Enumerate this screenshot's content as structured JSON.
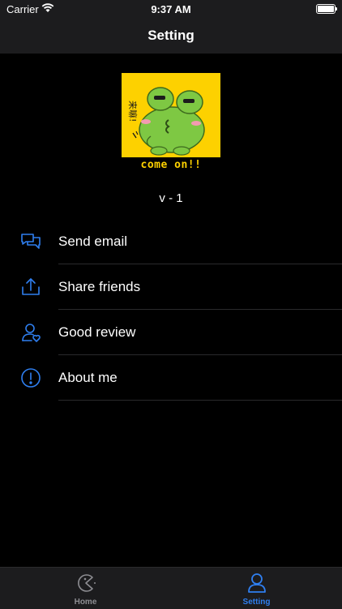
{
  "status_bar": {
    "carrier": "Carrier",
    "time": "9:37 AM"
  },
  "nav": {
    "title": "Setting"
  },
  "logo": {
    "caption": "come on!!",
    "badge_text": "来嘛!"
  },
  "version": "v - 1",
  "menu": [
    {
      "label": "Send email",
      "icon": "chat-bubbles-icon"
    },
    {
      "label": "Share friends",
      "icon": "share-icon"
    },
    {
      "label": "Good review",
      "icon": "user-heart-icon"
    },
    {
      "label": "About me",
      "icon": "info-circle-icon"
    }
  ],
  "tabs": [
    {
      "label": "Home",
      "icon": "pacman-icon",
      "selected": false
    },
    {
      "label": "Setting",
      "icon": "person-icon",
      "selected": true
    }
  ],
  "colors": {
    "accent": "#2f7ff0",
    "background": "#000000",
    "bar": "#1c1c1e",
    "logo_bg": "#fdd100",
    "frog": "#7ec843"
  }
}
